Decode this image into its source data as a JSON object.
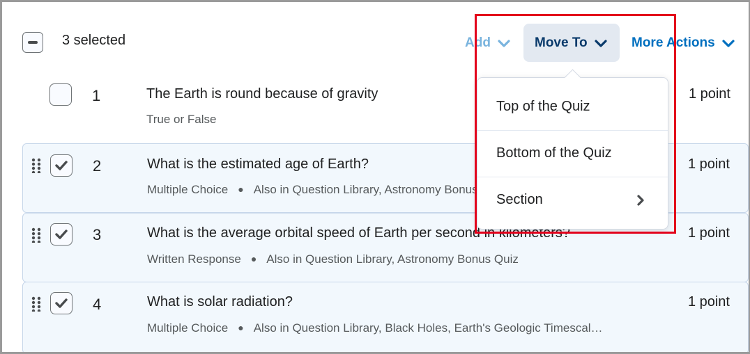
{
  "header": {
    "selected_count": "3 selected",
    "actions": {
      "add": "Add",
      "move_to": "Move To",
      "more_actions": "More Actions"
    }
  },
  "move_to_menu": {
    "items": [
      {
        "label": "Top of the Quiz",
        "has_submenu": false
      },
      {
        "label": "Bottom of the Quiz",
        "has_submenu": false
      },
      {
        "label": "Section",
        "has_submenu": true
      }
    ]
  },
  "questions": [
    {
      "number": "1",
      "title": "The Earth is round because of gravity",
      "type": "True or False",
      "also_in": "",
      "points": "1 point",
      "selected": false
    },
    {
      "number": "2",
      "title": "What is the estimated age of Earth?",
      "type": "Multiple Choice",
      "also_in": "Also in Question Library, Astronomy Bonus Quiz",
      "points": "1 point",
      "selected": true
    },
    {
      "number": "3",
      "title": "What is the average orbital speed of Earth per second in kilometers?",
      "type": "Written Response",
      "also_in": "Also in Question Library, Astronomy Bonus Quiz",
      "points": "1 point",
      "selected": true
    },
    {
      "number": "4",
      "title": "What is solar radiation?",
      "type": "Multiple Choice",
      "also_in": "Also in Question Library, Black Holes, Earth's Geologic Timescal…",
      "points": "1 point",
      "selected": true
    }
  ],
  "colors": {
    "accent": "#006fbf",
    "selected_row_bg": "#f2f8fd",
    "highlight_border": "#e3001b"
  }
}
